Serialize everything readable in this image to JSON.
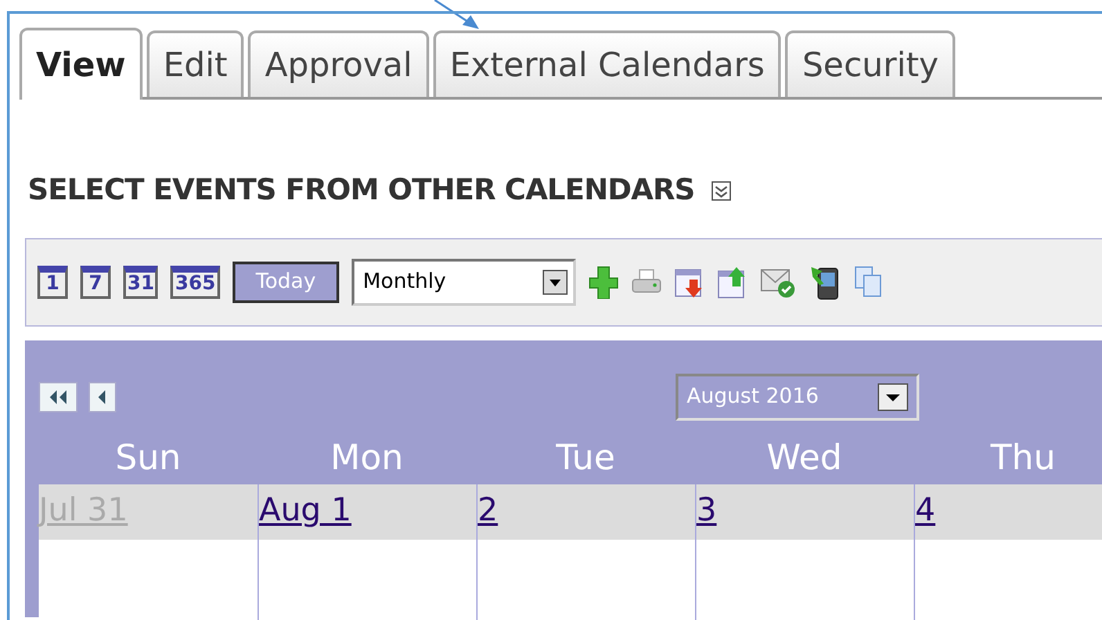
{
  "tabs": [
    {
      "label": "View",
      "selected": true
    },
    {
      "label": "Edit",
      "selected": false
    },
    {
      "label": "Approval",
      "selected": false
    },
    {
      "label": "External Calendars",
      "selected": false
    },
    {
      "label": "Security",
      "selected": false
    }
  ],
  "heading": "SELECT EVENTS FROM OTHER CALENDARS",
  "toolbar": {
    "view_buttons": [
      "1",
      "7",
      "31",
      "365"
    ],
    "today": "Today",
    "view_select": "Monthly"
  },
  "calendar": {
    "month_select": "August 2016",
    "weekdays": [
      "Sun",
      "Mon",
      "Tue",
      "Wed",
      "Thu"
    ],
    "days": [
      {
        "label": "Jul 31",
        "other_month": true
      },
      {
        "label": "Aug 1",
        "other_month": false
      },
      {
        "label": "2",
        "other_month": false
      },
      {
        "label": "3",
        "other_month": false
      },
      {
        "label": "4",
        "other_month": false
      }
    ]
  }
}
